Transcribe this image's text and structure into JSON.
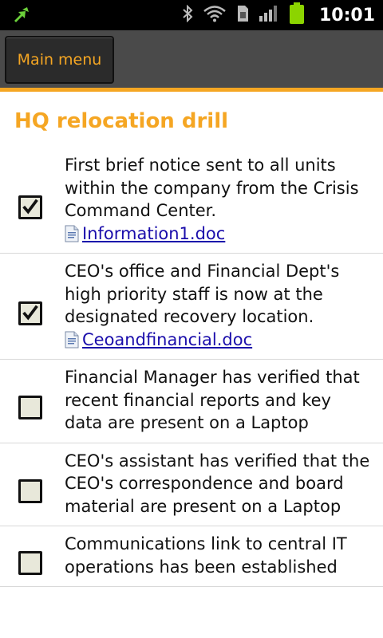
{
  "status_bar": {
    "time": "10:01",
    "icons": [
      "sync-icon",
      "bluetooth-icon",
      "wifi-icon",
      "sim-card-icon",
      "signal-icon",
      "battery-icon"
    ]
  },
  "action_bar": {
    "main_menu_label": "Main menu"
  },
  "colors": {
    "accent": "#f5a623",
    "link": "#1a0dab"
  },
  "page": {
    "title": "HQ relocation drill"
  },
  "items": [
    {
      "text": "First brief notice sent to all units within the company from the Crisis Command Center.",
      "checked": true,
      "attachment": "Information1.doc"
    },
    {
      "text": "CEO's office and Financial Dept's high priority staff is now at the designated recovery location.",
      "checked": true,
      "attachment": "Ceoandfinancial.doc"
    },
    {
      "text": "Financial Manager has verified that recent financial reports and key data are present on a Laptop",
      "checked": false,
      "attachment": null
    },
    {
      "text": "CEO's assistant has verified that the CEO's correspondence and board material are present on a Laptop",
      "checked": false,
      "attachment": null
    },
    {
      "text": "Communications link to central IT operations has been established",
      "checked": false,
      "attachment": null
    }
  ]
}
